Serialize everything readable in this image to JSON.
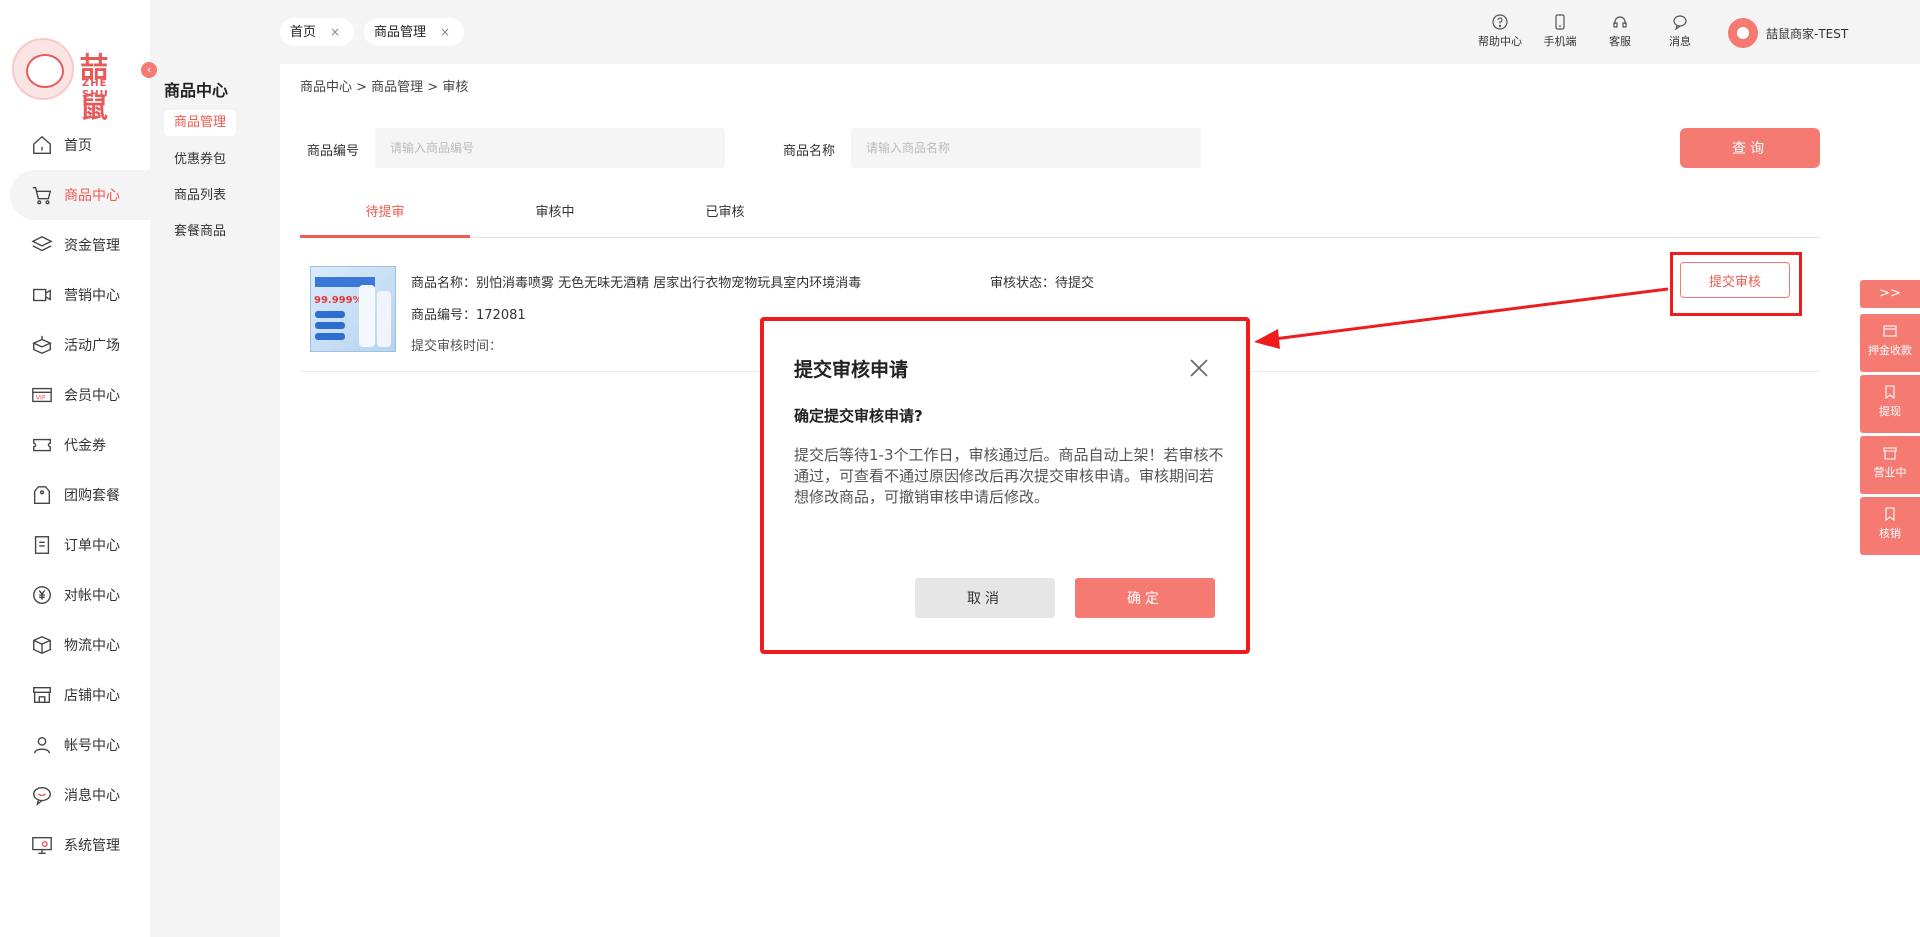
{
  "brand": {
    "logo_text": "喆鼠",
    "logo_sub": "ZHE SHU"
  },
  "sidebar": {
    "items": [
      {
        "label": "首页",
        "icon": "home-icon"
      },
      {
        "label": "商品中心",
        "icon": "cart-icon"
      },
      {
        "label": "资金管理",
        "icon": "layers-icon"
      },
      {
        "label": "营销中心",
        "icon": "marketing-icon"
      },
      {
        "label": "活动广场",
        "icon": "box-icon"
      },
      {
        "label": "会员中心",
        "icon": "vip-icon"
      },
      {
        "label": "代金券",
        "icon": "coupon-icon"
      },
      {
        "label": "团购套餐",
        "icon": "tag-icon"
      },
      {
        "label": "订单中心",
        "icon": "order-icon"
      },
      {
        "label": "对帐中心",
        "icon": "yen-icon"
      },
      {
        "label": "物流中心",
        "icon": "package-icon"
      },
      {
        "label": "店铺中心",
        "icon": "store-icon"
      },
      {
        "label": "帐号中心",
        "icon": "user-icon"
      },
      {
        "label": "消息中心",
        "icon": "chat-icon"
      },
      {
        "label": "系统管理",
        "icon": "system-icon"
      }
    ],
    "active_index": 1
  },
  "subbar": {
    "title": "商品中心",
    "items": [
      "商品管理",
      "优惠券包",
      "商品列表",
      "套餐商品"
    ]
  },
  "top_tabs": [
    {
      "label": "首页",
      "close": "×"
    },
    {
      "label": "商品管理",
      "close": "×"
    }
  ],
  "toolbar": {
    "help": "帮助中心",
    "mobile": "手机端",
    "service": "客服",
    "message": "消息",
    "user_name": "喆鼠商家-TEST"
  },
  "breadcrumb": "商品中心 > 商品管理 > 审核",
  "search": {
    "code_label": "商品编号",
    "code_placeholder": "请输入商品编号",
    "name_label": "商品名称",
    "name_placeholder": "请输入商品名称",
    "query_label": "查询"
  },
  "status_tabs": [
    "待提审",
    "审核中",
    "已审核"
  ],
  "product": {
    "name_line": "商品名称：别怕消毒喷雾 无色无味无酒精 居家出行衣物宠物玩具室内环境消毒",
    "code_line": "商品编号：172081",
    "time_line": "提交审核时间：",
    "status_line": "审核状态：待提交",
    "thumb_percent": "99.999%",
    "submit_label": "提交审核"
  },
  "right_float": {
    "toggle": ">>",
    "items": [
      "押金收款",
      "提现",
      "营业中",
      "核销"
    ]
  },
  "modal": {
    "title": "提交审核申请",
    "question": "确定提交审核申请?",
    "body": "提交后等待1-3个工作日，审核通过后。商品自动上架！若审核不通过，可查看不通过原因修改后再次提交审核申请。审核期间若想修改商品，可撤销审核申请后修改。",
    "cancel": "取消",
    "confirm": "确定"
  },
  "colors": {
    "accent": "#f47a72",
    "accent_text": "#f05a4f",
    "annotation": "#ee1c1c"
  }
}
